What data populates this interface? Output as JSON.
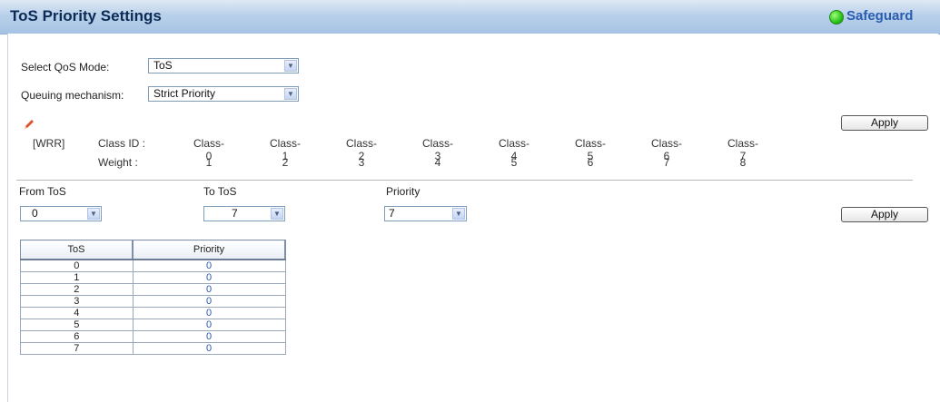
{
  "header": {
    "title": "ToS Priority Settings",
    "safeguard_label": "Safeguard",
    "safeguard_status_color": "#2cc21b"
  },
  "qos": {
    "mode_label": "Select QoS Mode:",
    "mode_value": "ToS",
    "queue_label": "Queuing mechanism:",
    "queue_value": "Strict Priority",
    "apply_label": "Apply",
    "edit_icon": "pencil-icon"
  },
  "wrr": {
    "tag": "[WRR]",
    "class_id_label": "Class ID :",
    "weight_label": "Weight :",
    "classes": [
      "Class-0",
      "Class-1",
      "Class-2",
      "Class-3",
      "Class-4",
      "Class-5",
      "Class-6",
      "Class-7"
    ],
    "weights": [
      "1",
      "2",
      "3",
      "4",
      "5",
      "6",
      "7",
      "8"
    ]
  },
  "tos_form": {
    "from_label": "From ToS",
    "from_value": "0",
    "to_label": "To ToS",
    "to_value": "7",
    "priority_label": "Priority",
    "priority_value": "7",
    "apply_label": "Apply"
  },
  "table": {
    "headers": [
      "ToS",
      "Priority"
    ],
    "rows": [
      [
        "0",
        "0"
      ],
      [
        "1",
        "0"
      ],
      [
        "2",
        "0"
      ],
      [
        "3",
        "0"
      ],
      [
        "4",
        "0"
      ],
      [
        "5",
        "0"
      ],
      [
        "6",
        "0"
      ],
      [
        "7",
        "0"
      ]
    ]
  }
}
